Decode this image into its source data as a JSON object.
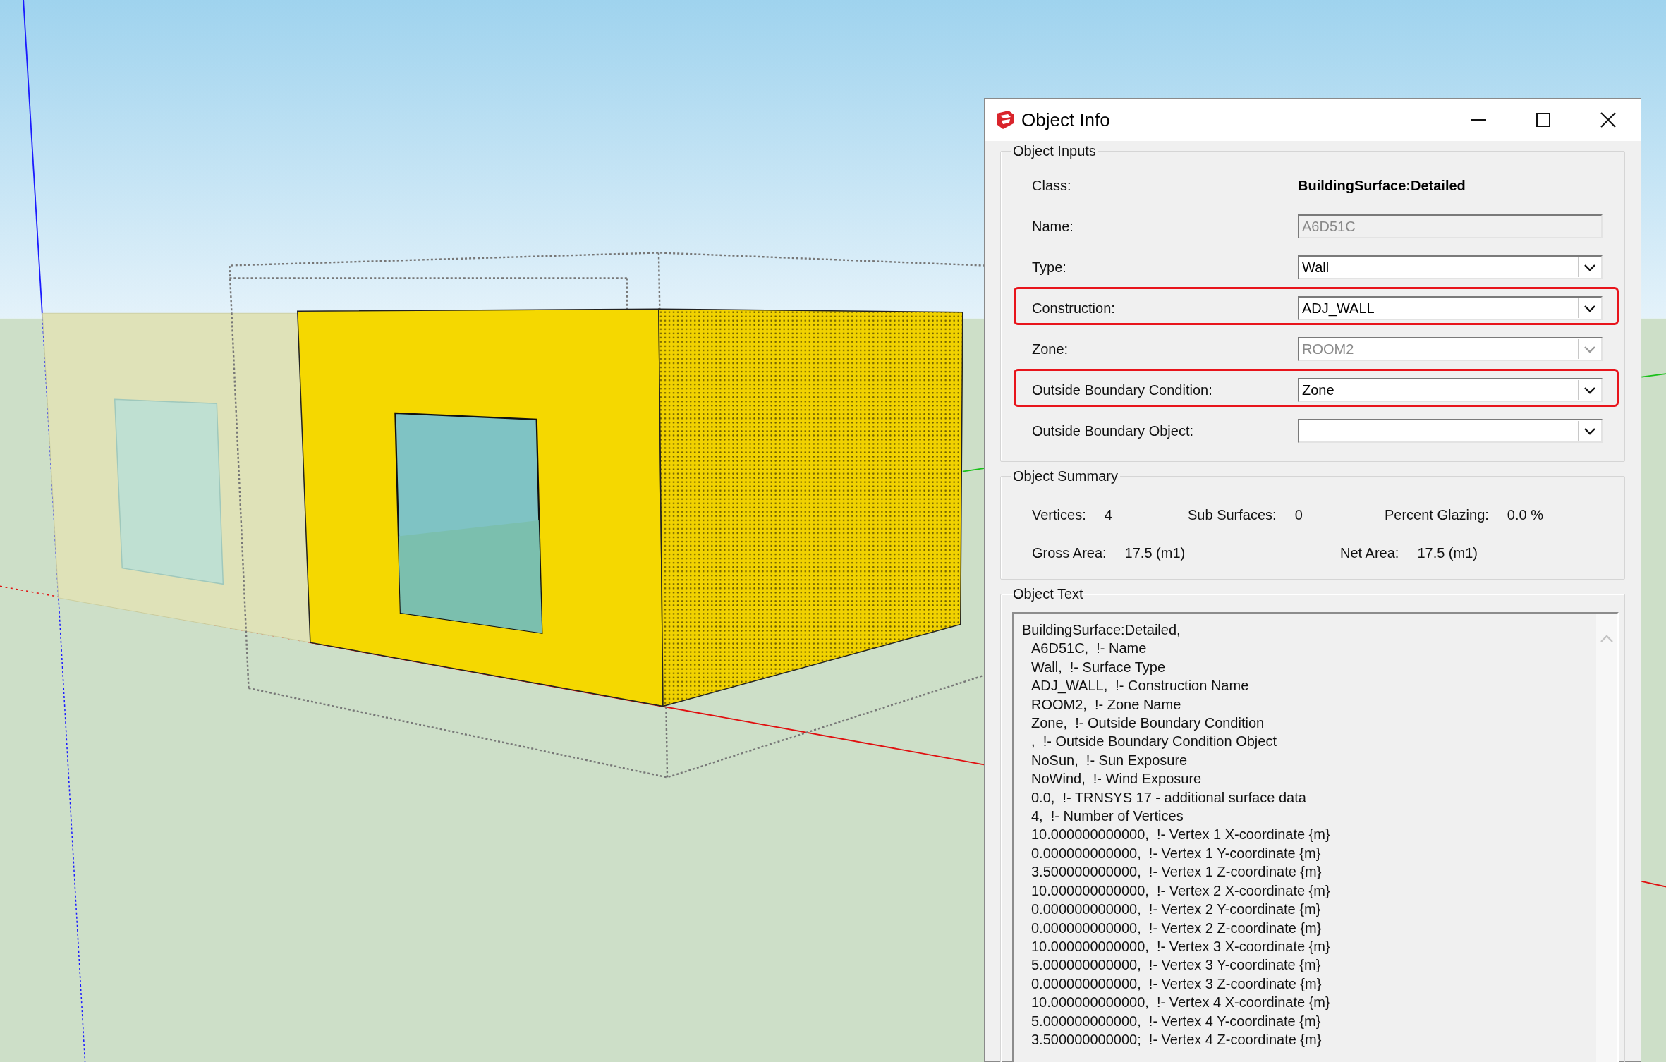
{
  "window": {
    "title": "Object Info"
  },
  "object_inputs": {
    "title": "Object Inputs",
    "rows": [
      {
        "kind": "static",
        "label": "Class:",
        "value": "BuildingSurface:Detailed",
        "highlighted": false
      },
      {
        "kind": "text",
        "label": "Name:",
        "value": "A6D51C",
        "disabled": true,
        "highlighted": false
      },
      {
        "kind": "dropdown",
        "label": "Type:",
        "value": "Wall",
        "disabled": false,
        "highlighted": false
      },
      {
        "kind": "dropdown",
        "label": "Construction:",
        "value": "ADJ_WALL",
        "disabled": false,
        "highlighted": true
      },
      {
        "kind": "dropdown",
        "label": "Zone:",
        "value": "ROOM2",
        "disabled": true,
        "highlighted": false
      },
      {
        "kind": "dropdown",
        "label": "Outside Boundary Condition:",
        "value": "Zone",
        "disabled": false,
        "highlighted": true
      },
      {
        "kind": "dropdown",
        "label": "Outside Boundary Object:",
        "disabled": false,
        "highlighted": false
      }
    ]
  },
  "object_summary": {
    "title": "Object Summary",
    "rows": [
      {
        "items": [
          {
            "label": "Vertices:",
            "value": "4"
          },
          {
            "label": "Sub Surfaces:",
            "value": "0"
          },
          {
            "label": "Percent Glazing:",
            "value": "0.0 %"
          }
        ]
      },
      {
        "items": [
          {
            "label": "Gross Area:",
            "value": "17.5 (m1)"
          },
          {
            "label": "Net Area:",
            "value": "17.5 (m1)"
          }
        ]
      }
    ]
  },
  "object_text": {
    "title": "Object Text",
    "header": "BuildingSurface:Detailed,",
    "fields": [
      "A6D51C,  !- Name",
      "Wall,  !- Surface Type",
      "ADJ_WALL,  !- Construction Name",
      "ROOM2,  !- Zone Name",
      "Zone,  !- Outside Boundary Condition",
      ",  !- Outside Boundary Condition Object",
      "NoSun,  !- Sun Exposure",
      "NoWind,  !- Wind Exposure",
      "0.0,  !- TRNSYS 17 - additional surface data",
      "4,  !- Number of Vertices",
      "10.000000000000,  !- Vertex 1 X-coordinate {m}",
      "0.000000000000,  !- Vertex 1 Y-coordinate {m}",
      "3.500000000000,  !- Vertex 1 Z-coordinate {m}",
      "10.000000000000,  !- Vertex 2 X-coordinate {m}",
      "0.000000000000,  !- Vertex 2 Y-coordinate {m}",
      "0.000000000000,  !- Vertex 2 Z-coordinate {m}",
      "10.000000000000,  !- Vertex 3 X-coordinate {m}",
      "5.000000000000,  !- Vertex 3 Y-coordinate {m}",
      "0.000000000000,  !- Vertex 3 Z-coordinate {m}",
      "10.000000000000,  !- Vertex 4 X-coordinate {m}",
      "5.000000000000,  !- Vertex 4 Y-coordinate {m}",
      "3.500000000000;  !- Vertex 4 Z-coordinate {m}"
    ]
  }
}
